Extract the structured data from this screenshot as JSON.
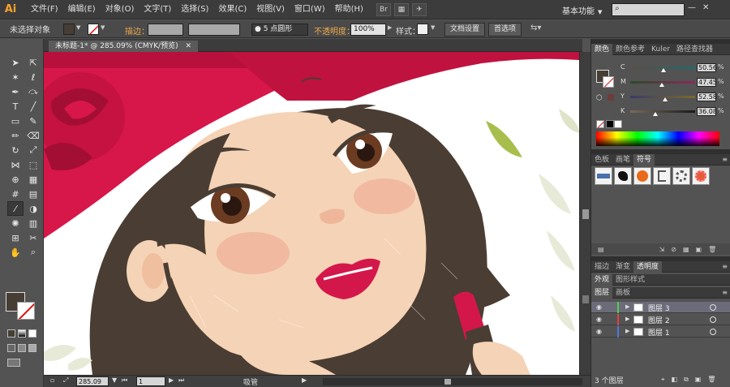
{
  "menubar": {
    "logo": "Ai",
    "items": [
      "文件(F)",
      "编辑(E)",
      "对象(O)",
      "文字(T)",
      "选择(S)",
      "效果(C)",
      "视图(V)",
      "窗口(W)",
      "帮助(H)"
    ],
    "icons": [
      "bridge-icon",
      "arrange-documents-icon",
      "gpu-performance-icon"
    ],
    "workspace": "基本功能",
    "search_placeholder": ""
  },
  "controlbar": {
    "selection_status": "未选择对象",
    "stroke_label": "描边：",
    "brush_value": "5 点圆形",
    "opacity_label": "不透明度：",
    "opacity_value": "100%",
    "style_label": "样式：",
    "doc_setup_btn": "文档设置",
    "preferences_btn": "首选项"
  },
  "document": {
    "tab_title": "未标题-1* @ 285.09% (CMYK/预览)"
  },
  "statusbar": {
    "zoom": "285.09",
    "page": "1",
    "current_tool": "吸管"
  },
  "panels": {
    "color_tabs": [
      "颜色",
      "颜色参考",
      "Kuler",
      "路径查找器"
    ],
    "cmyk": [
      {
        "label": "C",
        "value": "50.56",
        "pct": "%"
      },
      {
        "label": "M",
        "value": "47.45",
        "pct": "%"
      },
      {
        "label": "Y",
        "value": "52.58",
        "pct": "%"
      },
      {
        "label": "K",
        "value": "36.08",
        "pct": "%"
      }
    ],
    "swatch_tabs": [
      "色板",
      "画笔",
      "符号"
    ],
    "stroke_tabs": [
      "描边",
      "渐变",
      "透明度"
    ],
    "appearance_tabs": [
      "外观",
      "图形样式"
    ],
    "layer_tabs": [
      "图层",
      "画板"
    ],
    "layers": [
      "图层 3",
      "图层 2",
      "图层 1"
    ],
    "layer_count": "3 个图层"
  },
  "colors": {
    "fill": "#463d34",
    "hat": "#d7164a",
    "skin": "#f5d3b6",
    "hair": "#4a3d33",
    "lips": "#d4174a",
    "cheek": "#f0b9a0"
  }
}
